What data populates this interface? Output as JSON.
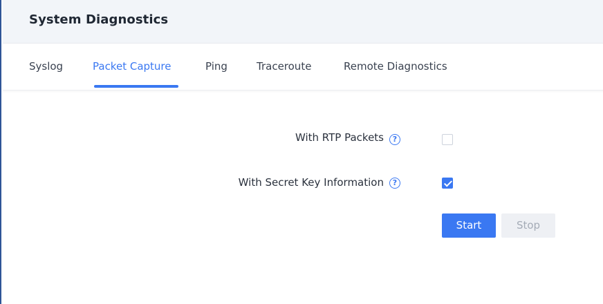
{
  "header": {
    "title": "System Diagnostics"
  },
  "tabs": [
    {
      "label": "Syslog",
      "active": false
    },
    {
      "label": "Packet Capture",
      "active": true
    },
    {
      "label": "Ping",
      "active": false
    },
    {
      "label": "Traceroute",
      "active": false
    },
    {
      "label": "Remote Diagnostics",
      "active": false
    }
  ],
  "form": {
    "rtp_packets": {
      "label": "With RTP Packets",
      "checked": false
    },
    "secret_key": {
      "label": "With Secret Key Information",
      "checked": true
    }
  },
  "buttons": {
    "start": "Start",
    "stop": "Stop"
  },
  "colors": {
    "accent": "#3a78f2",
    "frame": "#2f5597"
  },
  "icons": {
    "help": "question-circle-icon",
    "check": "checkmark-icon"
  }
}
